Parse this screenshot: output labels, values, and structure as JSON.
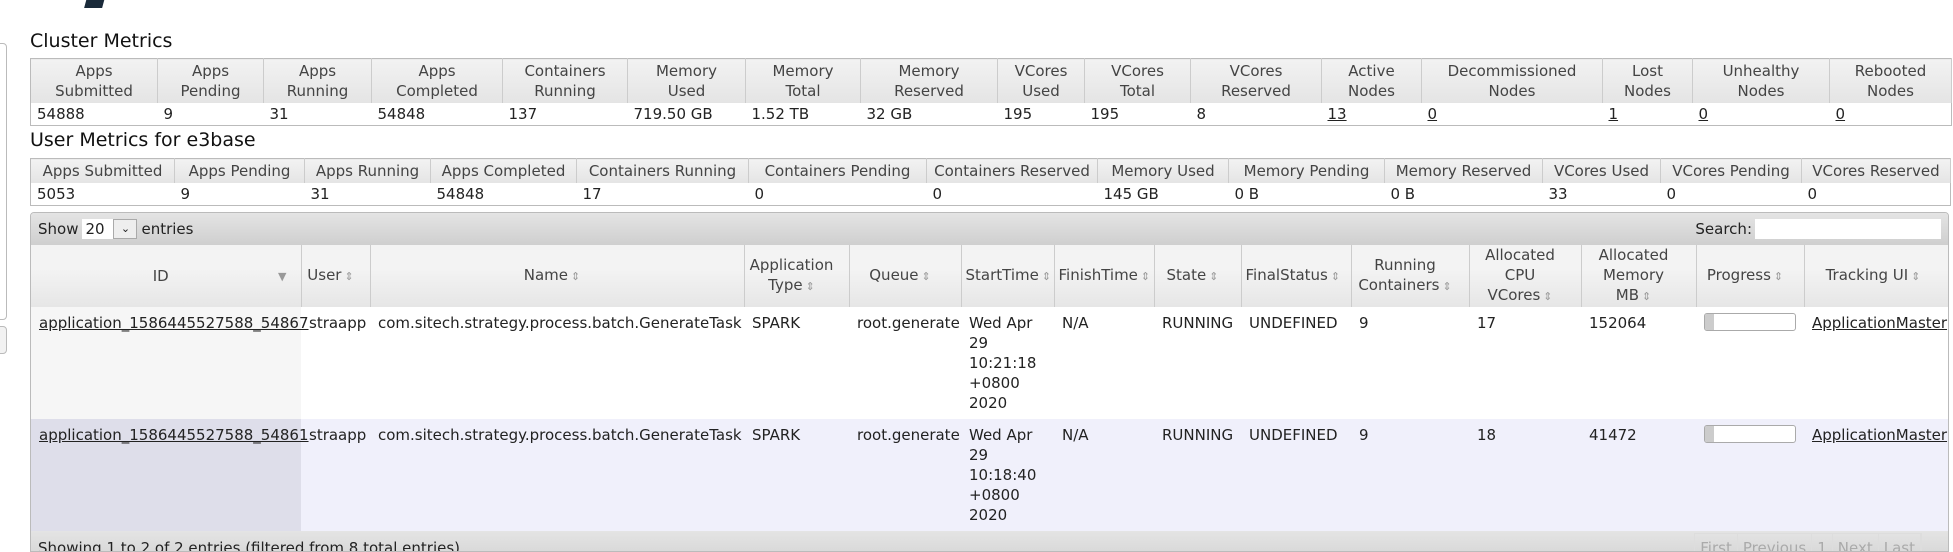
{
  "cluster": {
    "title": "Cluster Metrics",
    "headers": [
      [
        "Apps",
        "Submitted"
      ],
      [
        "Apps",
        "Pending"
      ],
      [
        "Apps",
        "Running"
      ],
      [
        "Apps",
        "Completed"
      ],
      [
        "Containers",
        "Running"
      ],
      [
        "Memory",
        "Used"
      ],
      [
        "Memory",
        "Total"
      ],
      [
        "Memory",
        "Reserved"
      ],
      [
        "VCores",
        "Used"
      ],
      [
        "VCores",
        "Total"
      ],
      [
        "VCores",
        "Reserved"
      ],
      [
        "Active",
        "Nodes"
      ],
      [
        "Decommissioned",
        "Nodes"
      ],
      [
        "Lost",
        "Nodes"
      ],
      [
        "Unhealthy",
        "Nodes"
      ],
      [
        "Rebooted",
        "Nodes"
      ]
    ],
    "values": [
      "54888",
      "9",
      "31",
      "54848",
      "137",
      "719.50 GB",
      "1.52 TB",
      "32 GB",
      "195",
      "195",
      "8",
      "13",
      "0",
      "1",
      "0",
      "0"
    ]
  },
  "user": {
    "title": "User Metrics for e3base",
    "headers": [
      "Apps Submitted",
      "Apps Pending",
      "Apps Running",
      "Apps Completed",
      "Containers Running",
      "Containers Pending",
      "Containers Reserved",
      "Memory Used",
      "Memory Pending",
      "Memory Reserved",
      "VCores Used",
      "VCores Pending",
      "VCores Reserved"
    ],
    "values": [
      "5053",
      "9",
      "31",
      "54848",
      "17",
      "0",
      "0",
      "145 GB",
      "0 B",
      "0 B",
      "33",
      "0",
      "0"
    ]
  },
  "table": {
    "show": "Show",
    "entries_value": "20",
    "entries": "entries",
    "search_label": "Search:",
    "search_value": "",
    "headers": [
      [
        "ID"
      ],
      [
        "User"
      ],
      [
        "Name"
      ],
      [
        "Application",
        "Type"
      ],
      [
        "Queue"
      ],
      [
        "StartTime"
      ],
      [
        "FinishTime"
      ],
      [
        "State"
      ],
      [
        "FinalStatus"
      ],
      [
        "Running",
        "Containers"
      ],
      [
        "Allocated",
        "CPU VCores"
      ],
      [
        "Allocated",
        "Memory MB"
      ],
      [
        "Progress"
      ],
      [
        "Tracking UI"
      ]
    ],
    "rows": [
      {
        "id": "application_1586445527588_54867",
        "user": "straapp",
        "name": "com.sitech.strategy.process.batch.GenerateTask",
        "type": "SPARK",
        "queue": "root.generate",
        "start": [
          "Wed Apr",
          "29",
          "10:21:18",
          "+0800",
          "2020"
        ],
        "finish": "N/A",
        "state": "RUNNING",
        "final": "UNDEFINED",
        "containers": "9",
        "vcores": "17",
        "memory": "152064",
        "progress": 10,
        "tracking": "ApplicationMaster"
      },
      {
        "id": "application_1586445527588_54861",
        "user": "straapp",
        "name": "com.sitech.strategy.process.batch.GenerateTask",
        "type": "SPARK",
        "queue": "root.generate",
        "start": [
          "Wed Apr",
          "29",
          "10:18:40",
          "+0800",
          "2020"
        ],
        "finish": "N/A",
        "state": "RUNNING",
        "final": "UNDEFINED",
        "containers": "9",
        "vcores": "18",
        "memory": "41472",
        "progress": 10,
        "tracking": "ApplicationMaster"
      }
    ],
    "info": "Showing 1 to 2 of 2 entries (filtered from 8 total entries)",
    "pager": [
      "First",
      "Previous",
      "1",
      "Next",
      "Last"
    ]
  }
}
